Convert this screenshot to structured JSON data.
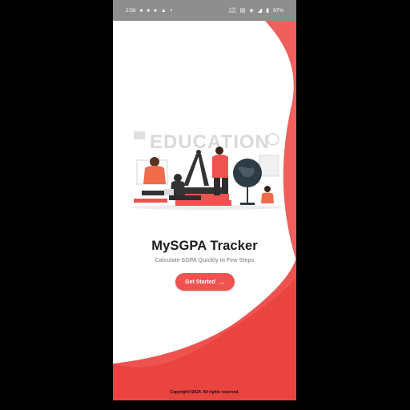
{
  "status_bar": {
    "time": "2:56",
    "left_icons": [
      "snapchat-icon",
      "snapchat-icon",
      "snapchat-icon",
      "drive-icon",
      "more-dot"
    ],
    "net_speed_value": "0.00",
    "net_speed_unit": "KB/S",
    "battery": "97%"
  },
  "app": {
    "title": "MySGPA Tracker",
    "subtitle": "Calculate SGPA Quickly In Few Steps",
    "cta_label": "Get Started",
    "illustration_title": "EDUCATION",
    "copyright": "Copyright©2024. All rights reserved."
  },
  "colors": {
    "accent": "#ef5350",
    "accent_dark": "#e53935",
    "status_bar": "#8e8e8e",
    "title": "#1c1c1c",
    "subtitle": "#9a9a9a"
  }
}
